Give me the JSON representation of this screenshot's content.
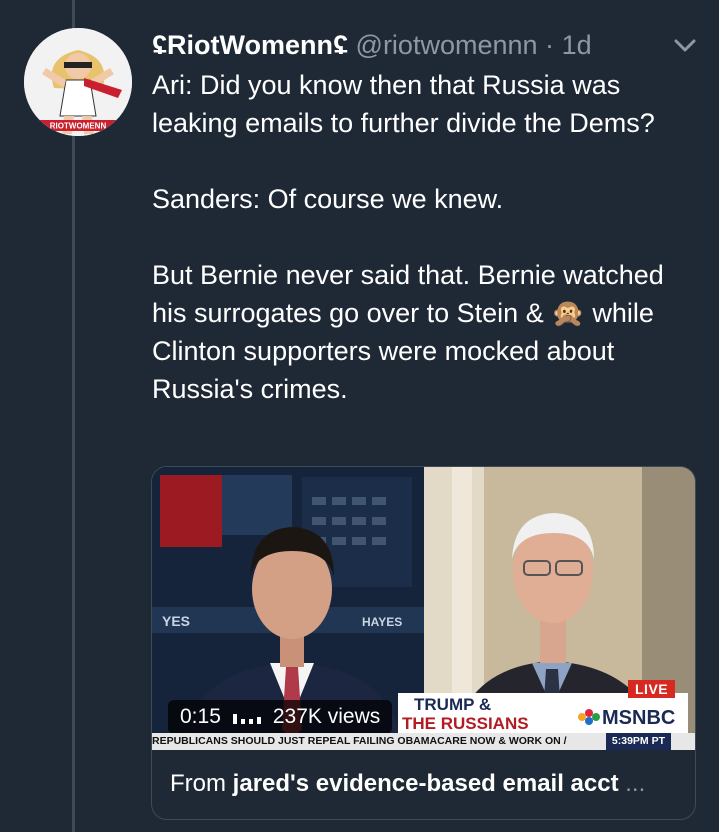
{
  "tweet": {
    "display_name": "ʢRiotWomennʢ",
    "handle": "@riotwomennn",
    "separator": "·",
    "timestamp": "1d",
    "paragraphs": [
      "Ari: Did you know then that Russia was leaking emails to further divide the Dems?",
      "Sanders: Of course we knew.",
      "But Bernie never said that. Bernie watched his surrogates go over to Stein & 🙊 while Clinton supporters were mocked about Russia's crimes."
    ]
  },
  "avatar": {
    "label": "RIOTWOMENN"
  },
  "video": {
    "duration": "0:15",
    "views": "237K views",
    "banner_line1": "TRUMP &",
    "banner_line2": "THE RUSSIANS",
    "network": "MSNBC",
    "live_label": "LIVE",
    "ticker_text": "REPUBLICANS SHOULD JUST REPEAL FAILING OBAMACARE NOW & WORK ON /",
    "ticker_time": "5:39PM PT",
    "studio_text_left": "YES",
    "studio_text_right": "HAYES"
  },
  "card": {
    "prefix": "From ",
    "source": "jared's evidence-based email acct",
    "ellipsis": " ..."
  },
  "colors": {
    "background": "#1f2935",
    "secondary_text": "#8b98a5",
    "border": "#3d4a57",
    "live_red": "#d62a21",
    "msnbc_blue": "#1a2a55"
  },
  "icons": [
    "chevron-down-icon",
    "views-icon",
    "msnbc-peacock-icon"
  ]
}
